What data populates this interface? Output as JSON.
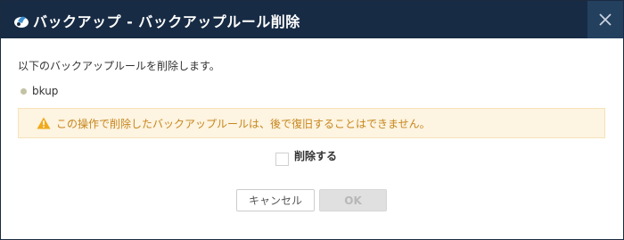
{
  "dialog": {
    "title": "バックアップ - バックアップルール削除",
    "close_icon": "close-icon",
    "app_icon": "backup-app-icon"
  },
  "content": {
    "message": "以下のバックアップルールを削除します。",
    "rule_name": "bkup",
    "warning": "この操作で削除したバックアップルールは、後で復旧することはできません。",
    "warning_icon": "warning-icon",
    "confirm_label": "削除する",
    "confirm_checked": false
  },
  "buttons": {
    "cancel_label": "キャンセル",
    "ok_label": "OK",
    "ok_enabled": false
  },
  "colors": {
    "titlebar": "#172b44",
    "close_bg": "#23405f",
    "warning_bg": "#fdf4e1",
    "warning_text": "#c7861d",
    "bullet": "#c3c2a4"
  }
}
